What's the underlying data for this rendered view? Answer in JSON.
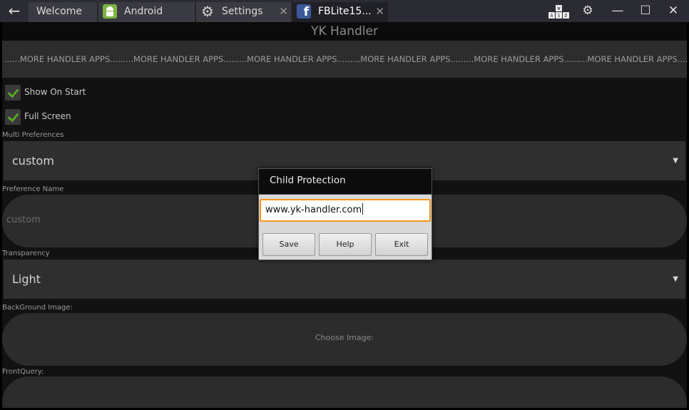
{
  "tabs": [
    {
      "label": "Welcome"
    },
    {
      "label": "Android"
    },
    {
      "label": "Settings"
    },
    {
      "label": "FBLite15..."
    }
  ],
  "toolbar": {
    "keymap_keys": [
      "W",
      "A",
      "S",
      "D"
    ]
  },
  "app": {
    "title": "YK Handler",
    "ticker_text": "......MORE HANDLER APPS.........MORE HANDLER APPS.........MORE HANDLER APPS.........MORE HANDLER APPS.........MORE HANDLER APPS.........MORE HANDLER APPS.........MORE HANDLER APPS",
    "show_on_start": {
      "label": "Show On Start",
      "checked": true
    },
    "full_screen": {
      "label": "Full Screen",
      "checked": true
    },
    "multi_preferences": {
      "label": "Multi Preferences",
      "value": "custom"
    },
    "preference_name": {
      "label": "Preference Name",
      "value": "custom"
    },
    "transparency": {
      "label": "Transparency",
      "value": "Light"
    },
    "background_image": {
      "label": "BackGround Image:",
      "button": "Choose Image:"
    },
    "front_query": {
      "label": "FrontQuery:"
    }
  },
  "dialog": {
    "title": "Child Protection",
    "input_value": "www.yk-handler.com",
    "buttons": {
      "save": "Save",
      "help": "Help",
      "exit": "Exit"
    }
  },
  "colors": {
    "tab_bar": "#2b2c33",
    "app_bg": "#121212",
    "accent_check": "#5aa329",
    "input_focus": "#f7961e",
    "facebook": "#3b5998",
    "android": "#7cb342"
  }
}
